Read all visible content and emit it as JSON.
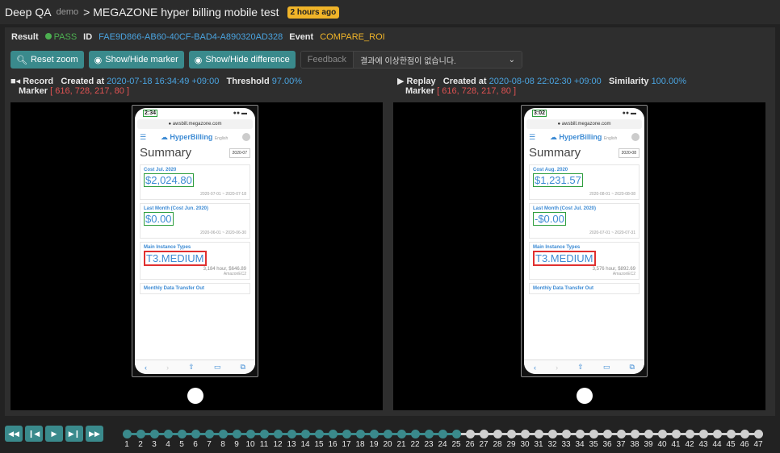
{
  "header": {
    "brand": "Deep QA",
    "demo": "demo",
    "title": "> MEGAZONE hyper billing mobile test",
    "badge": "2 hours ago"
  },
  "info": {
    "result_label": "Result",
    "result_value": "PASS",
    "id_label": "ID",
    "id_value": "FAE9D866-AB60-40CF-BAD4-A890320AD328",
    "event_label": "Event",
    "event_value": "COMPARE_ROI"
  },
  "toolbar": {
    "reset_zoom": "Reset zoom",
    "toggle_marker": "Show/Hide marker",
    "toggle_difference": "Show/Hide difference",
    "feedback_label": "Feedback",
    "feedback_value": "결과에 이상한점이 없습니다."
  },
  "record": {
    "label": "Record",
    "created_label": "Created at",
    "created_value": "2020-07-18 16:34:49 +09:00",
    "threshold_label": "Threshold",
    "threshold_value": "97.00%",
    "marker_label": "Marker",
    "marker_value": "[ 616, 728, 217, 80 ]",
    "phone": {
      "time": "2:34",
      "url": "awsbill.megazone.com",
      "logo": "HyperBilling",
      "lang": "English",
      "summary": "Summary",
      "datesel": "2020-07",
      "card1_title": "Cost Jul. 2020",
      "card1_value": "$2,024.80",
      "card1_date": "2020-07-01 ~ 2020-07-18",
      "card2_title": "Last Month (Cost Jun. 2020)",
      "card2_value": "$0.00",
      "card2_date": "2020-06-01 ~ 2020-06-30",
      "card3_title": "Main Instance Types",
      "card3_value": "T3.MEDIUM",
      "card3_sub": "3,184 hour, $646.89",
      "card3_sub2": "AmazonEC2",
      "card4_title": "Monthly Data Transfer Out"
    }
  },
  "replay": {
    "label": "Replay",
    "created_label": "Created at",
    "created_value": "2020-08-08 22:02:30 +09:00",
    "similarity_label": "Similarity",
    "similarity_value": "100.00%",
    "marker_label": "Marker",
    "marker_value": "[ 616, 728, 217, 80 ]",
    "phone": {
      "time": "3:02",
      "url": "awsbill.megazone.com",
      "logo": "HyperBilling",
      "lang": "English",
      "summary": "Summary",
      "datesel": "2020-08",
      "card1_title": "Cost Aug. 2020",
      "card1_value": "$1,231.57",
      "card1_date": "2020-08-01 ~ 2020-08-08",
      "card2_title": "Last Month (Cost Jul. 2020)",
      "card2_value": "-$0.00",
      "card2_date": "2020-07-01 ~ 2020-07-31",
      "card3_title": "Main Instance Types",
      "card3_value": "T3.MEDIUM",
      "card3_sub": "3,576 hour, $892.69",
      "card3_sub2": "AmazonEC2",
      "card4_title": "Monthly Data Transfer Out"
    }
  },
  "timeline": {
    "total": 47,
    "current": 25,
    "active_color": "#3a8a8c",
    "inactive_color": "#cfcfcf"
  },
  "colors": {
    "accent": "#3a8a8c",
    "pass": "#4caf50",
    "link": "#4aa3df",
    "event": "#f0b429",
    "marker": "#e05252"
  }
}
